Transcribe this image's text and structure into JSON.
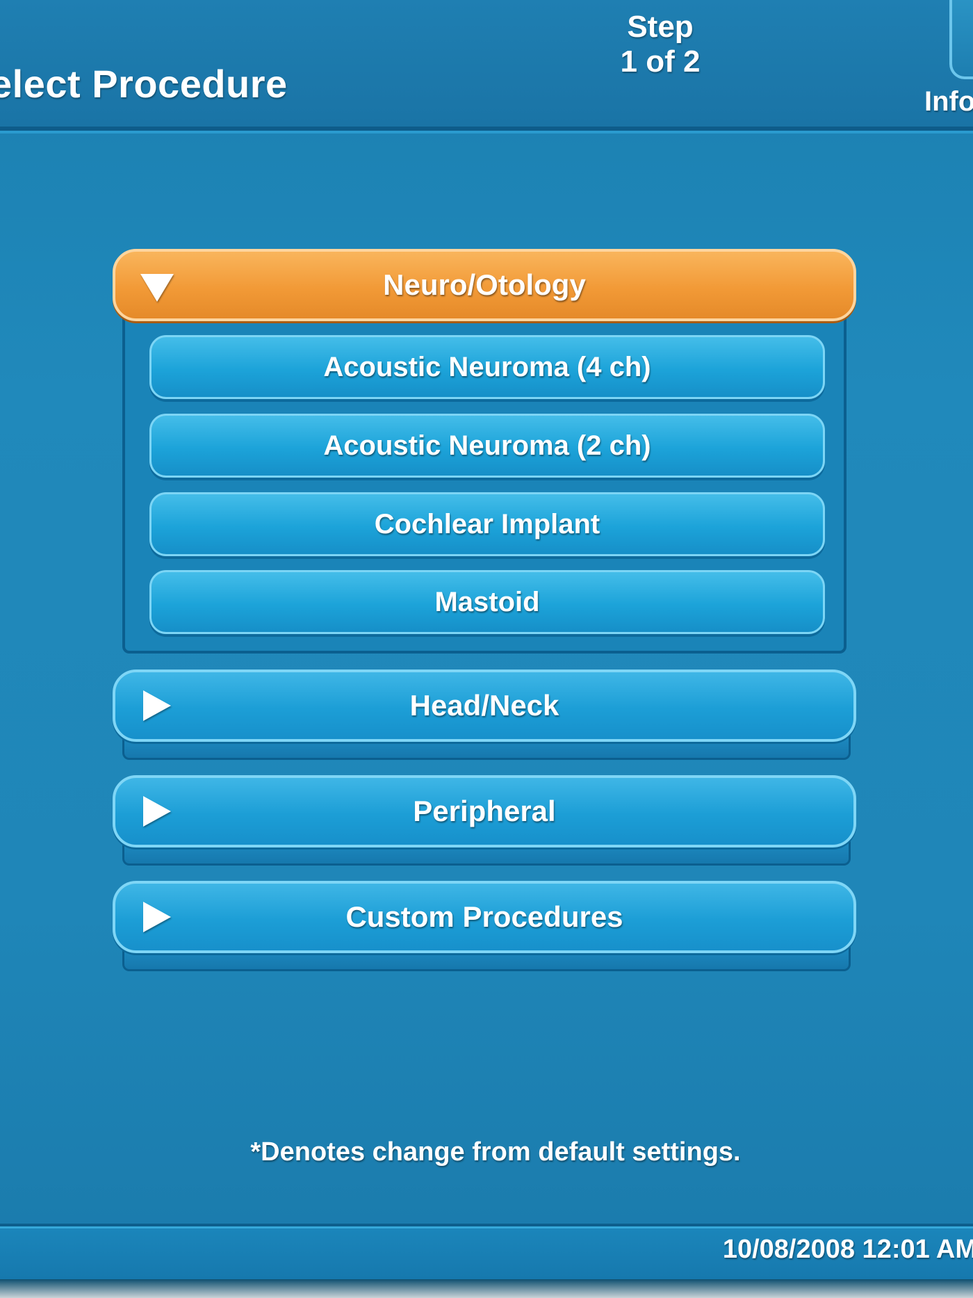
{
  "header": {
    "title": "elect Procedure",
    "step_label": "Step",
    "step_value": "1 of 2",
    "info_label": "Info"
  },
  "categories": [
    {
      "label": "Neuro/Otology",
      "state": "expanded",
      "items": [
        {
          "label": "Acoustic Neuroma (4 ch)"
        },
        {
          "label": "Acoustic Neuroma (2 ch)"
        },
        {
          "label": "Cochlear Implant"
        },
        {
          "label": "Mastoid"
        }
      ]
    },
    {
      "label": "Head/Neck",
      "state": "collapsed"
    },
    {
      "label": "Peripheral",
      "state": "collapsed"
    },
    {
      "label": "Custom Procedures",
      "state": "collapsed"
    }
  ],
  "footnote": "*Denotes change from default settings.",
  "status_bar": {
    "datetime": "10/08/2008 12:01 AM"
  },
  "colors": {
    "background": "#1e85b5",
    "expanded_accent": "#f29a37",
    "button_blue": "#1ca3d9"
  }
}
